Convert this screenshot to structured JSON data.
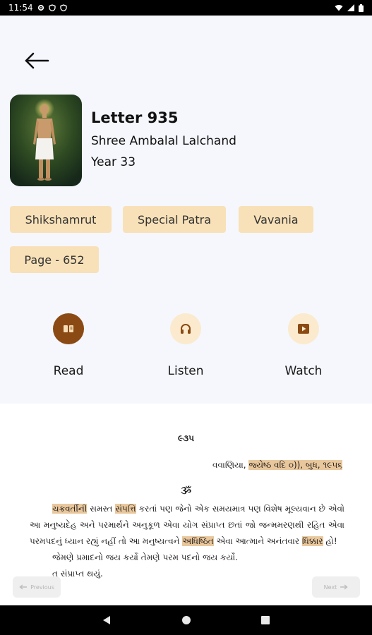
{
  "status_bar": {
    "time": "11:54"
  },
  "letter": {
    "title": "Letter 935",
    "recipient": "Shree Ambalal Lalchand",
    "year": "Year 33"
  },
  "tags": [
    "Shikshamrut",
    "Special Patra",
    "Vavania",
    "Page - 652"
  ],
  "actions": [
    {
      "label": "Read",
      "icon": "book-icon"
    },
    {
      "label": "Listen",
      "icon": "headphones-icon"
    },
    {
      "label": "Watch",
      "icon": "video-play-icon"
    }
  ],
  "document": {
    "number": "૯૩૫",
    "date_prefix": "વવાણિયા,",
    "date_highlight": "જ્યેષ્ઠ વદિ ૦)), બુધ, ૧૯૫૬",
    "om": "ૐ",
    "para1_parts": [
      {
        "t": "ચક્રવર્તીની",
        "hl": true
      },
      {
        "t": " સમસ્ત ",
        "hl": false
      },
      {
        "t": "સંપત્તિ",
        "hl": true
      },
      {
        "t": " કરતાં પણ જેનો એક સમયમાત્ર પણ વિશેષ મૂલ્યવાન છે એવો આ મનુષ્યદેહ અને પરમાર્થને અનુકૂળ એવા યોગ સંપ્રાપ્ત છતાં જો જન્મમરણથી રહિત એવા પરમપદનું ધ્યાન રહ્યું નહીં તો આ મનુષ્યત્વને ",
        "hl": false
      },
      {
        "t": "અધિષ્ઠિત",
        "hl": true
      },
      {
        "t": " એવા આત્માને અનંતવાર ",
        "hl": false
      },
      {
        "t": "ધિક્કાર",
        "hl": true
      },
      {
        "t": " હો!",
        "hl": false
      }
    ],
    "para2": "જેમણે પ્રમાદનો જય કર્યો તેમણે પરમ પદનો જય કર્યો.",
    "para3": "ત સંપ્રાપ્ત થયું."
  },
  "nav": {
    "previous": "Previous",
    "next": "Next"
  },
  "colors": {
    "accent": "#8b4a13",
    "chip": "#f8e1b8",
    "icon_bg": "#fbeacd",
    "highlight": "#e9c79c"
  }
}
